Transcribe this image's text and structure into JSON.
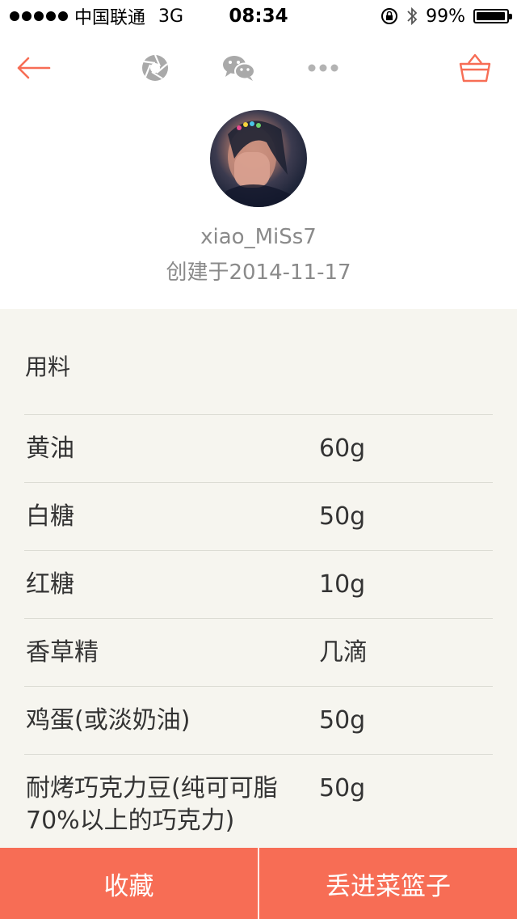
{
  "status_bar": {
    "carrier": "中国联通",
    "network": "3G",
    "time": "08:34",
    "battery": "99%",
    "battery_level": 0.99
  },
  "nav": {
    "back_icon": "arrow-left-icon",
    "icons": [
      "aperture-icon",
      "wechat-icon",
      "more-icon",
      "basket-icon"
    ],
    "accent_color": "#f76d55",
    "icon_gray": "#a9a9a9"
  },
  "profile": {
    "username": "xiao_MiSs7",
    "created": "创建于2014-11-17"
  },
  "ingredients": {
    "title": "用料",
    "items": [
      {
        "name": "黄油",
        "amount": "60g"
      },
      {
        "name": "白糖",
        "amount": "50g"
      },
      {
        "name": "红糖",
        "amount": "10g"
      },
      {
        "name": "香草精",
        "amount": "几滴"
      },
      {
        "name": "鸡蛋(或淡奶油)",
        "amount": "50g"
      },
      {
        "name": "耐烤巧克力豆(纯可可脂70%以上的巧克力)",
        "amount": "50g"
      }
    ]
  },
  "bottom_bar": {
    "favorite": "收藏",
    "add_to_basket": "丢进菜篮子",
    "color": "#f76d55"
  }
}
